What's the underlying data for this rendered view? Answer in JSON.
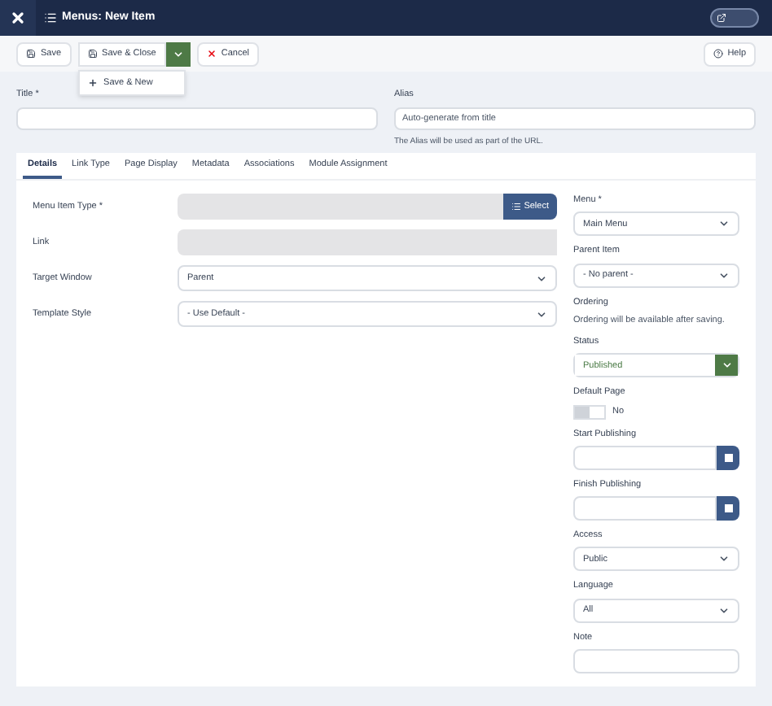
{
  "header": {
    "title": "Menus: New Item"
  },
  "toolbar": {
    "buttons": [
      {
        "label": "Save",
        "kind": "save"
      },
      {
        "label": "Save & Close",
        "kind": "save-split"
      },
      {
        "label": "Cancel",
        "kind": "cancel"
      }
    ],
    "menu": [
      {
        "label": "Save & New"
      }
    ],
    "help": {
      "label": "Help"
    }
  },
  "title_field": {
    "label": "Title *"
  },
  "alias_field": {
    "label": "Alias",
    "placeholder": "Auto-generate from title",
    "hint": "The Alias will be used as part of the URL."
  },
  "tabs": [
    {
      "label": "Details",
      "selected": true
    },
    {
      "label": "Link Type",
      "selected": false
    },
    {
      "label": "Page Display",
      "selected": false
    },
    {
      "label": "Metadata",
      "selected": false
    },
    {
      "label": "Associations",
      "selected": false
    },
    {
      "label": "Module Assignment",
      "selected": false
    }
  ],
  "left_fields": [
    {
      "label": "Menu Item Type *",
      "kind": "readonly",
      "button": "Select"
    },
    {
      "label": "Link",
      "kind": "readonly"
    },
    {
      "label": "Target Window",
      "kind": "select",
      "value": "Parent"
    },
    {
      "label": "Template Style",
      "kind": "select",
      "value": "- Use Default -"
    }
  ],
  "right_fields": [
    {
      "label": "Menu *",
      "kind": "select",
      "value": "Main Menu"
    },
    {
      "label": "Parent Item",
      "kind": "select",
      "value": "- No parent -"
    },
    {
      "label": "Ordering",
      "kind": "note",
      "value": "Ordering will be available after saving."
    },
    {
      "label": "Status",
      "kind": "status",
      "value": "Published"
    },
    {
      "label": "Default Page",
      "kind": "toggle",
      "on": false,
      "value": "No"
    },
    {
      "label": "Start Publishing",
      "kind": "date"
    },
    {
      "label": "Finish Publishing",
      "kind": "date"
    },
    {
      "label": "Access",
      "kind": "select",
      "value": "Public"
    },
    {
      "label": "Language",
      "kind": "select",
      "value": "All"
    },
    {
      "label": "Note",
      "kind": "text"
    }
  ]
}
